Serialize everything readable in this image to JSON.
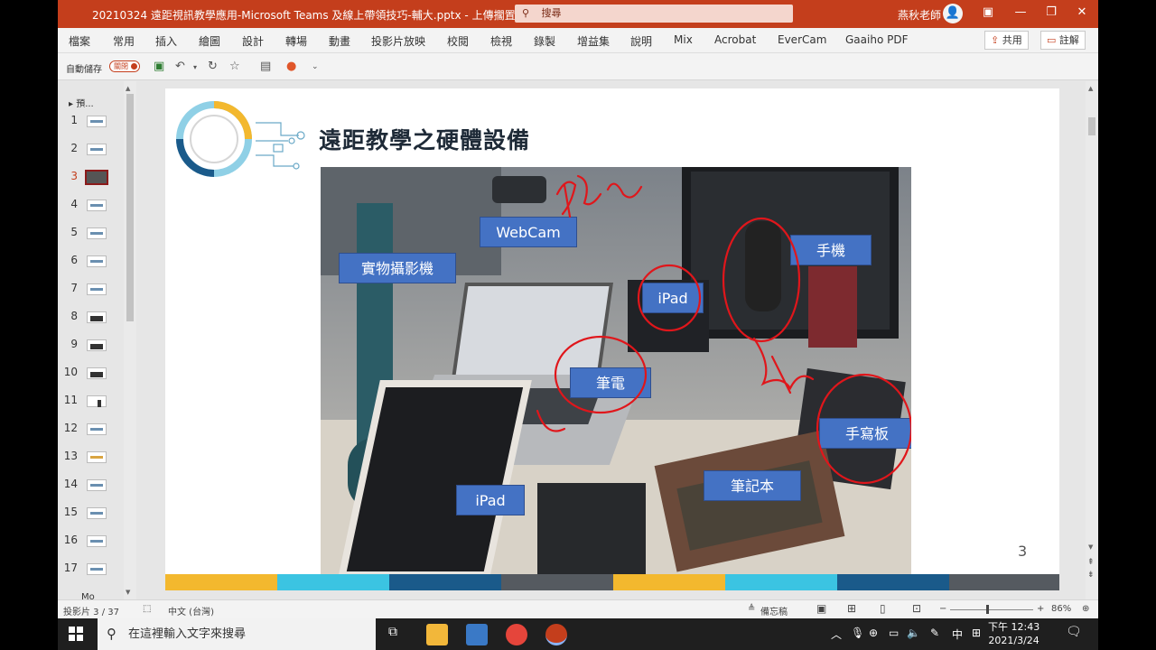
{
  "titlebar": {
    "doc_title": "20210324 遠距視訊教學應用-Microsoft Teams 及線上帶領技巧-輔大.pptx - 上傳擱置中",
    "search_placeholder": "搜尋",
    "user_name": "燕秋老師",
    "bg": "#c43e1c"
  },
  "ribbon": {
    "tabs": [
      "檔案",
      "常用",
      "插入",
      "繪圖",
      "設計",
      "轉場",
      "動畫",
      "投影片放映",
      "校閱",
      "檢視",
      "錄製",
      "增益集",
      "說明",
      "Mix",
      "Acrobat",
      "EverCam",
      "Gaaiho PDF"
    ],
    "share_label": "共用",
    "comments_label": "註解"
  },
  "qat": {
    "autosave_label": "自動儲存",
    "autosave_state": "關閉"
  },
  "thumbnails": {
    "header": "預...",
    "numbers": [
      "1",
      "2",
      "3",
      "4",
      "5",
      "6",
      "7",
      "8",
      "9",
      "10",
      "11",
      "12",
      "13",
      "14",
      "15",
      "16",
      "17"
    ],
    "selected": "3",
    "more": "Mo"
  },
  "slide": {
    "title": "遠距教學之硬體設備",
    "page_number": "3",
    "labels": {
      "webcam": "WebCam",
      "document_camera": "實物攝影機",
      "phone": "手機",
      "ipad_top": "iPad",
      "laptop": "筆電",
      "tablet": "手寫板",
      "ipad_bottom": "iPad",
      "notebook": "筆記本"
    },
    "label_color": "#4472c4",
    "band_colors": [
      "#f3b82e",
      "#3bc4e2",
      "#1a5a8a",
      "#555a60",
      "#f3b82e",
      "#3bc4e2",
      "#1a5a8a",
      "#555a60"
    ]
  },
  "status": {
    "slide_info": "投影片 3 / 37",
    "language": "中文 (台灣)",
    "notes_label": "備忘稿",
    "zoom": "86%"
  },
  "taskbar": {
    "search_placeholder": "在這裡輸入文字來搜尋",
    "ime": "中",
    "time": "下午 12:43",
    "date": "2021/3/24"
  }
}
